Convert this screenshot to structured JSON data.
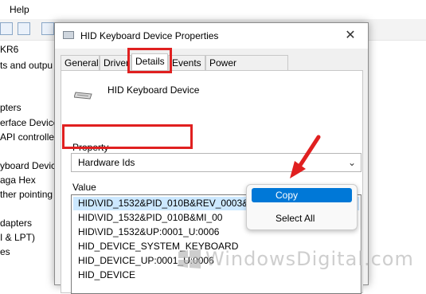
{
  "background": {
    "menu_help": "Help",
    "tree_items": [
      "KR6",
      "ts and outpu",
      "pters",
      "erface Device",
      "API controlle",
      "yboard Devic",
      "aga Hex",
      "ther pointing",
      "dapters",
      "I & LPT)",
      "es"
    ]
  },
  "dialog": {
    "title": "HID Keyboard Device Properties",
    "close": "✕",
    "tabs": [
      {
        "label": "General"
      },
      {
        "label": "Driver"
      },
      {
        "label": "Details"
      },
      {
        "label": "Events"
      },
      {
        "label": "Power Management"
      }
    ],
    "device_name": "HID Keyboard Device",
    "property_label": "Property",
    "property_value": "Hardware Ids",
    "property_chevron": "⌄",
    "value_label": "Value",
    "values": [
      "HID\\VID_1532&PID_010B&REV_0003&MI_00",
      "HID\\VID_1532&PID_010B&MI_00",
      "HID\\VID_1532&UP:0001_U:0006",
      "HID_DEVICE_SYSTEM_KEYBOARD",
      "HID_DEVICE_UP:0001_U:0006",
      "HID_DEVICE"
    ]
  },
  "context_menu": {
    "copy": "Copy",
    "select_all": "Select All"
  },
  "watermark": {
    "text": "WindowsDigital.com"
  },
  "colors": {
    "highlight": "#e02020",
    "selection": "#cce8ff",
    "menu_accent": "#0078d7"
  }
}
